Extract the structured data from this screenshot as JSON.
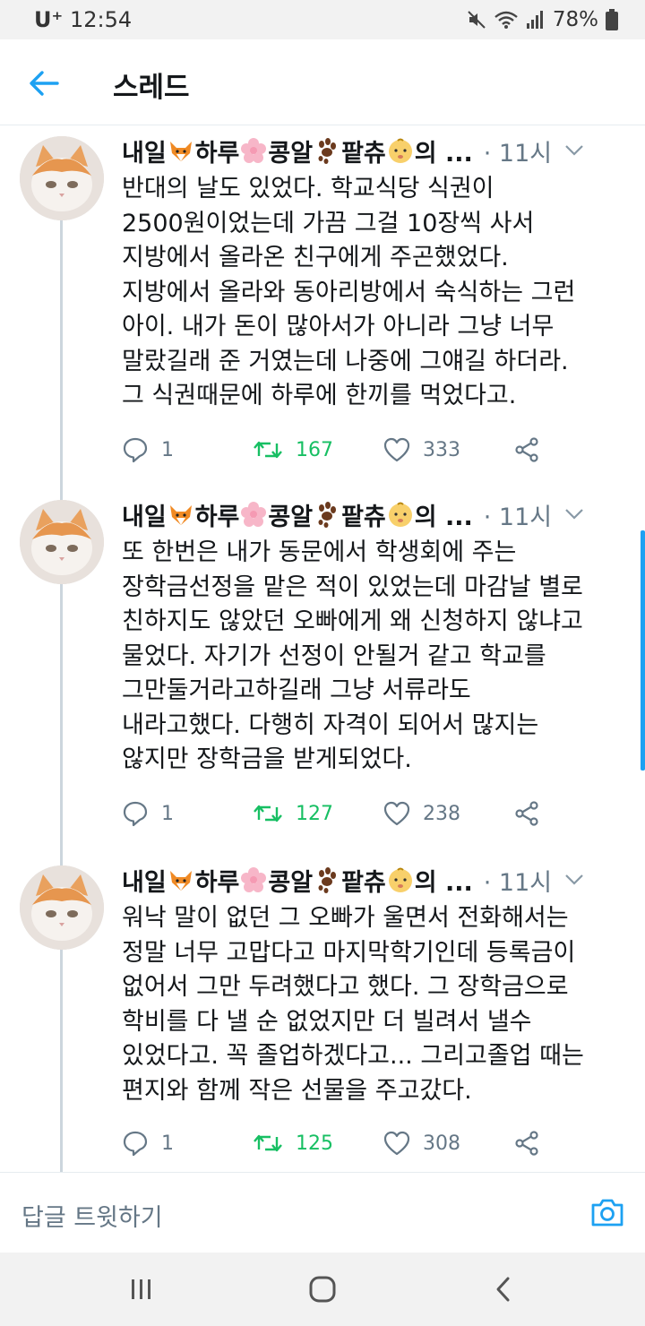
{
  "status_bar": {
    "carrier": "U⁺",
    "time": "12:54",
    "battery": "78%"
  },
  "header": {
    "back_icon": "arrow-left-icon",
    "title": "스레드"
  },
  "colors": {
    "accent": "#1da1f2",
    "retweet": "#17bf63",
    "muted": "#657786",
    "text": "#14171a"
  },
  "tweets": [
    {
      "author_parts": [
        "내일",
        "하루",
        "콩알",
        "팥츄",
        "의 ..."
      ],
      "author_icons": [
        "fox-emoji",
        "cherry-blossom-emoji",
        "paw-prints-emoji",
        "baby-emoji"
      ],
      "time": "· 11시",
      "text": "반대의 날도 있었다. 학교식당 식권이\n2500원이었는데 가끔 그걸 10장씩 사서\n지방에서 올라온 친구에게 주곤했었다.\n지방에서 올라와 동아리방에서 숙식하는 그런\n아이. 내가 돈이 많아서가 아니라 그냥 너무\n말랐길래 준 거였는데 나중에 그얘길 하더라.\n그 식권때문에 하루에 한끼를 먹었다고.",
      "replies": "1",
      "retweets": "167",
      "likes": "333"
    },
    {
      "author_parts": [
        "내일",
        "하루",
        "콩알",
        "팥츄",
        "의 ..."
      ],
      "author_icons": [
        "fox-emoji",
        "cherry-blossom-emoji",
        "paw-prints-emoji",
        "baby-emoji"
      ],
      "time": "· 11시",
      "text": "또 한번은 내가 동문에서 학생회에 주는\n장학금선정을 맡은 적이 있었는데 마감날 별로\n친하지도 않았던 오빠에게 왜 신청하지 않냐고\n물었다. 자기가 선정이 안될거 같고 학교를\n그만둘거라고하길래 그냥 서류라도\n내라고했다. 다행히 자격이 되어서 많지는\n않지만 장학금을 받게되었다.",
      "replies": "1",
      "retweets": "127",
      "likes": "238"
    },
    {
      "author_parts": [
        "내일",
        "하루",
        "콩알",
        "팥츄",
        "의 ..."
      ],
      "author_icons": [
        "fox-emoji",
        "cherry-blossom-emoji",
        "paw-prints-emoji",
        "baby-emoji"
      ],
      "time": "· 11시",
      "text": "워낙 말이 없던 그 오빠가 울면서 전화해서는\n정말 너무 고맙다고 마지막학기인데 등록금이\n없어서 그만 두려했다고 했다. 그 장학금으로\n학비를 다 낼 순 없었지만 더 빌려서 낼수\n있었다고. 꼭 졸업하겠다고... 그리고졸업 때는\n편지와 함께 작은 선물을 주고갔다.",
      "replies": "1",
      "retweets": "125",
      "likes": "308"
    }
  ],
  "reply_bar": {
    "placeholder": "답글 트윗하기",
    "camera_icon": "camera-icon"
  },
  "nav_bar": {
    "icons": [
      "recent-apps-icon",
      "home-icon",
      "back-icon"
    ]
  }
}
